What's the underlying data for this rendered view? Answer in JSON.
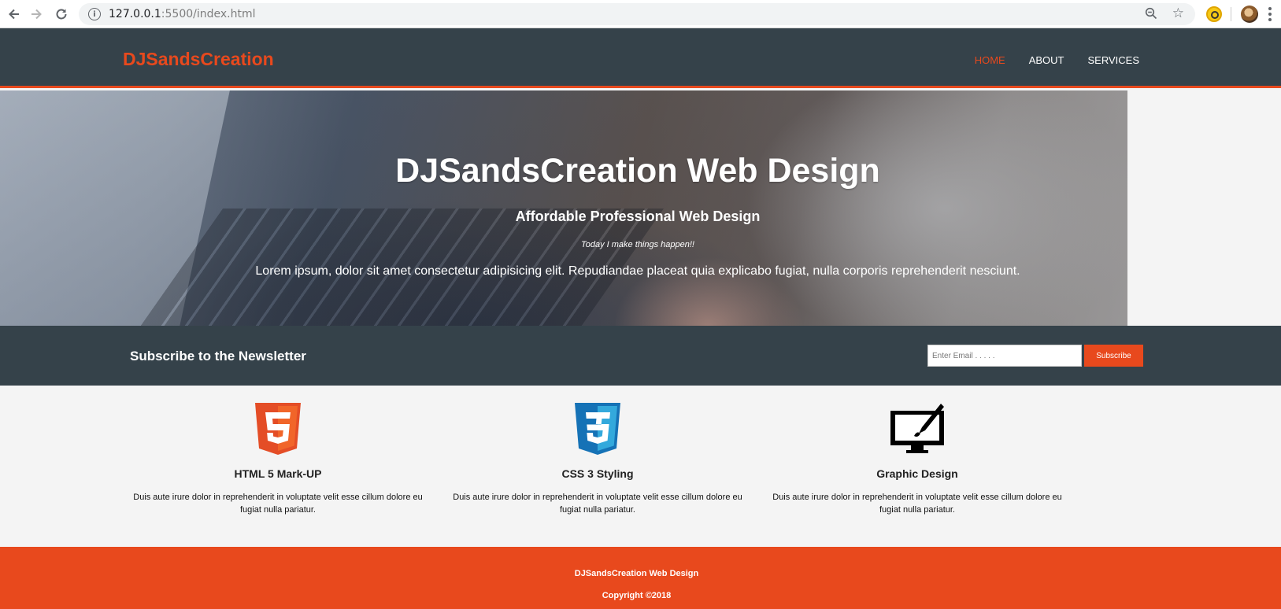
{
  "browser": {
    "url_host": "127.0.0.1",
    "url_rest": ":5500/index.html",
    "icons": [
      "back-icon",
      "forward-icon",
      "reload-icon",
      "info-icon",
      "zoom-icon",
      "star-icon",
      "extension-icon",
      "profile-avatar",
      "menu-icon"
    ]
  },
  "header": {
    "logo": "DJSandsCreation",
    "nav": [
      {
        "label": "HOME",
        "current": true
      },
      {
        "label": "ABOUT",
        "current": false
      },
      {
        "label": "SERVICES",
        "current": false
      }
    ]
  },
  "showcase": {
    "title": "DJSandsCreation Web Design",
    "subtitle": "Affordable Professional Web Design",
    "tagline": "Today I make things happen!!",
    "text": "Lorem ipsum, dolor sit amet consectetur adipisicing elit. Repudiandae placeat quia explicabo fugiat, nulla corporis reprehenderit nesciunt."
  },
  "newsletter": {
    "heading": "Subscribe to the Newsletter",
    "email_placeholder": "Enter Email . . . . .",
    "button_label": "Subscribe"
  },
  "boxes": [
    {
      "icon": "html5-icon",
      "title": "HTML 5 Mark-UP",
      "text": "Duis aute irure dolor in reprehenderit in voluptate velit esse cillum dolore eu fugiat nulla pariatur."
    },
    {
      "icon": "css3-icon",
      "title": "CSS 3 Styling",
      "text": "Duis aute irure dolor in reprehenderit in voluptate velit esse cillum dolore eu fugiat nulla pariatur."
    },
    {
      "icon": "graphic-design-icon",
      "title": "Graphic Design",
      "text": "Duis aute irure dolor in reprehenderit in voluptate velit esse cillum dolore eu fugiat nulla pariatur."
    }
  ],
  "footer": {
    "line1": "DJSandsCreation Web Design",
    "line2": "Copyright ©2018"
  },
  "colors": {
    "accent": "#e8491d",
    "dark": "#35424a",
    "background": "#f4f4f4"
  }
}
